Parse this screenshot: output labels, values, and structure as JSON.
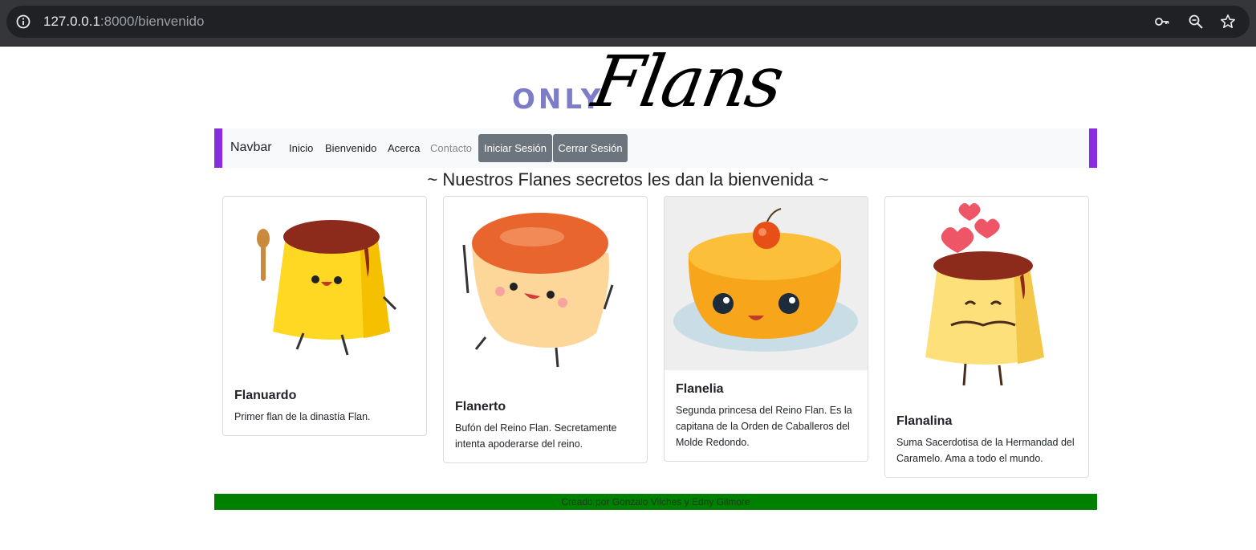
{
  "browser": {
    "url_host": "127.0.0.1",
    "url_rest": ":8000/bienvenido"
  },
  "logo": {
    "only": "ONLY",
    "flans": "Flans"
  },
  "navbar": {
    "brand": "Navbar",
    "links": [
      "Inicio",
      "Bienvenido",
      "Acerca",
      "Contacto"
    ],
    "login": "Iniciar Sesión",
    "logout": "Cerrar Sesión"
  },
  "headline": "~ Nuestros Flanes secretos les dan la bienvenida ~",
  "cards": [
    {
      "title": "Flanuardo",
      "text": "Primer flan de la dinastía Flan."
    },
    {
      "title": "Flanerto",
      "text": "Bufón del Reino Flan. Secretamente intenta apoderarse del reino."
    },
    {
      "title": "Flanelia",
      "text": "Segunda princesa del Reino Flan. Es la capitana de la Orden de Caballeros del Molde Redondo."
    },
    {
      "title": "Flanalina",
      "text": "Suma Sacerdotisa de la Hermandad del Caramelo. Ama a todo el mundo."
    }
  ],
  "footer": "Creado por Gonzalo Vilches y Edny Gilmore",
  "colors": {
    "nav_accent": "#8a2be2",
    "button": "#6c757d",
    "footer": "#008000",
    "logo_only": "#7c7cc8"
  }
}
